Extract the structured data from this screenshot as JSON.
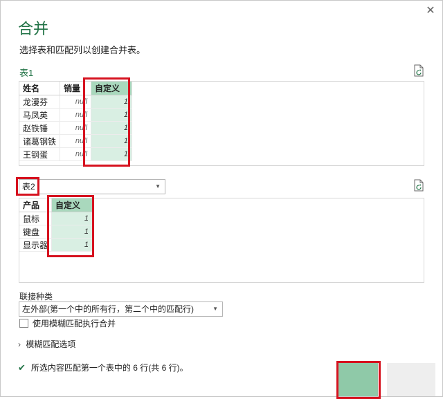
{
  "dialog": {
    "title": "合并",
    "description": "选择表和匹配列以创建合并表。"
  },
  "table1": {
    "label": "表1",
    "columns": [
      "姓名",
      "销量",
      "自定义"
    ],
    "rows": [
      [
        "龙漫芬",
        "null",
        "1"
      ],
      [
        "马凤英",
        "null",
        "1"
      ],
      [
        "赵铁锤",
        "null",
        "1"
      ],
      [
        "诸葛钢铁",
        "null",
        "1"
      ],
      [
        "王钢蛋",
        "null",
        "1"
      ]
    ]
  },
  "table2": {
    "selected": "表2",
    "columns": [
      "产品",
      "自定义"
    ],
    "rows": [
      [
        "鼠标",
        "1"
      ],
      [
        "键盘",
        "1"
      ],
      [
        "显示器",
        "1"
      ]
    ]
  },
  "join": {
    "label": "联接种类",
    "selected": "左外部(第一个中的所有行，第二个中的匹配行)"
  },
  "fuzzy": {
    "checkbox_label": "使用模糊匹配执行合并",
    "options_label": "模糊匹配选项"
  },
  "status": {
    "text": "所选内容匹配第一个表中的 6 行(共 6 行)。"
  },
  "colors": {
    "accent": "#217346",
    "selected_header": "#a9d8bd",
    "selected_cells": "#d9efe3",
    "highlight_border": "#d6121f"
  }
}
